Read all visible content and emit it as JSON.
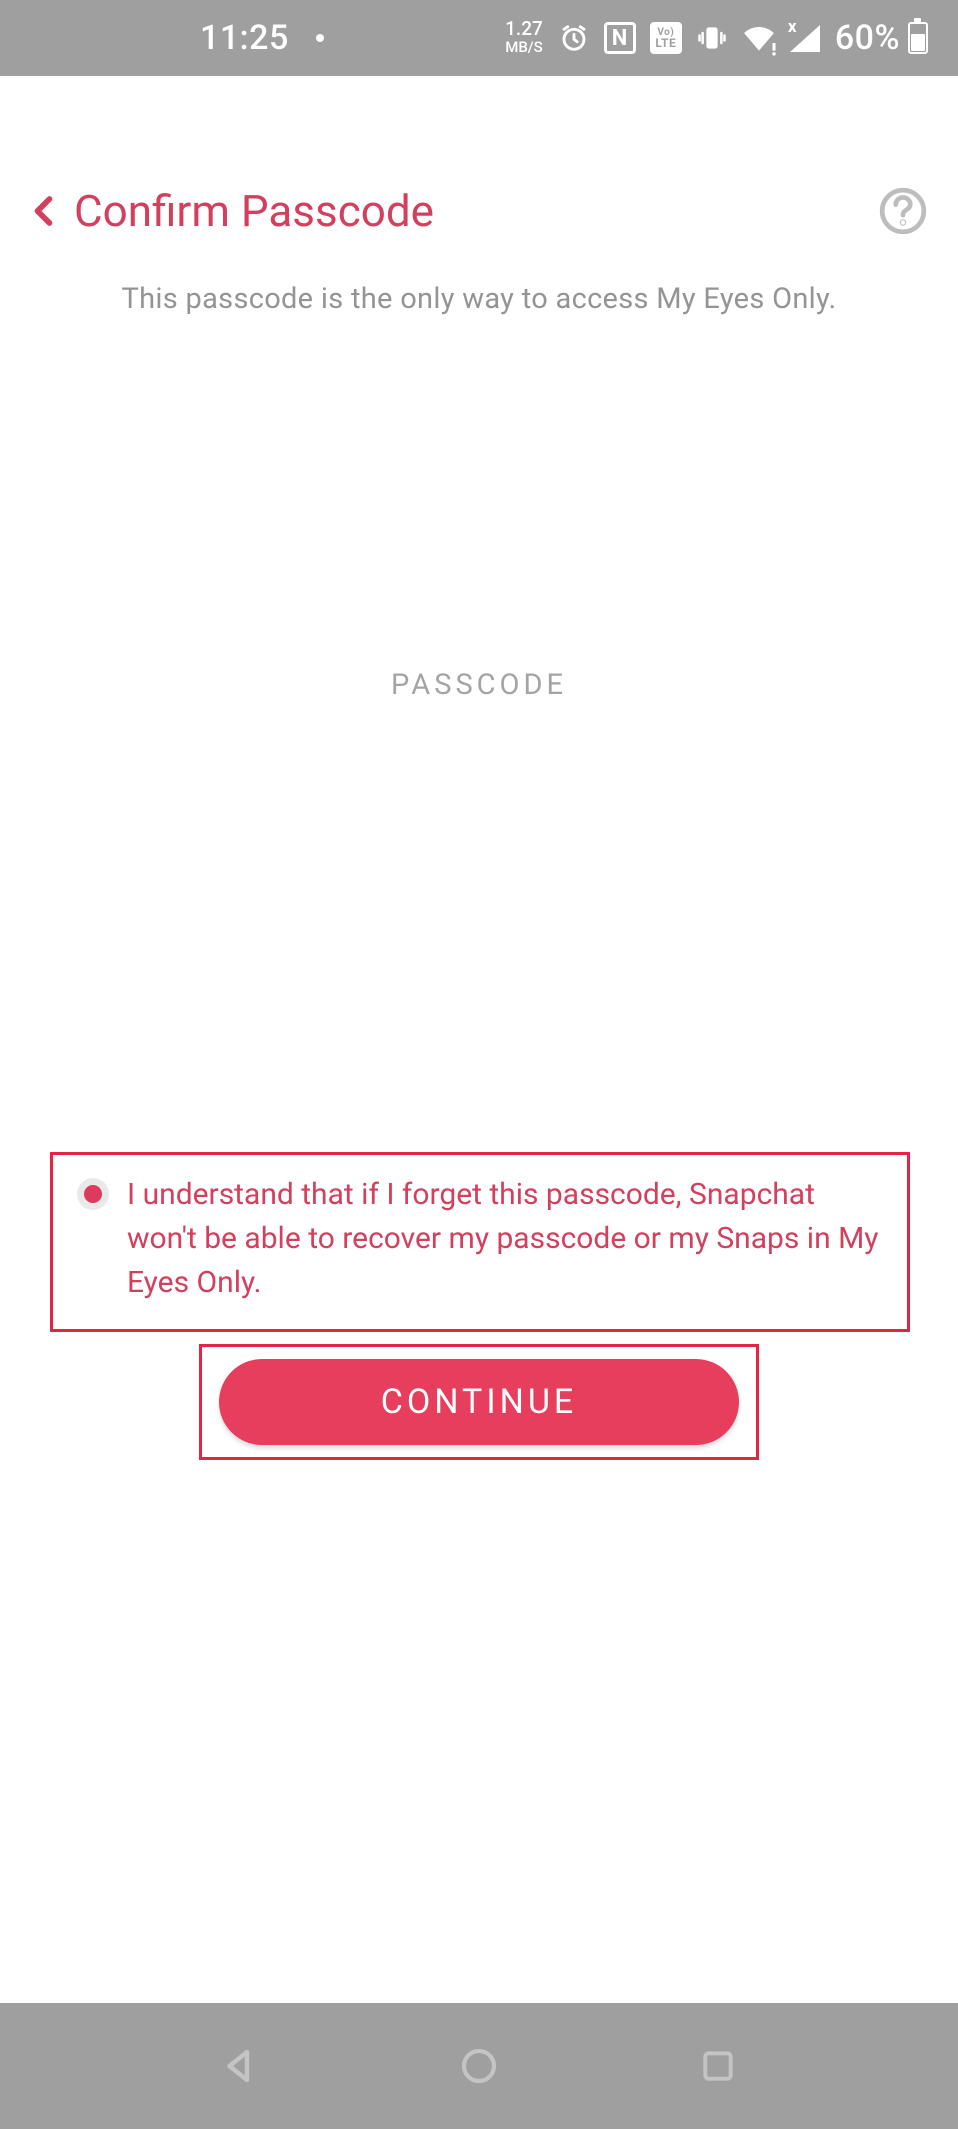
{
  "status_bar": {
    "time": "11:25",
    "net_speed_value": "1.27",
    "net_speed_unit": "MB/S",
    "volte_top": "Vo)",
    "volte_bot": "LTE",
    "battery_pct": "60%"
  },
  "header": {
    "title": "Confirm Passcode"
  },
  "subtitle": "This passcode is the only way to access My Eyes Only.",
  "passcode_label": "PASSCODE",
  "agreement": "I understand that if I forget this passcode, Snapchat won't be able to recover my passcode or my Snaps in My Eyes Only.",
  "continue_label": "CONTINUE",
  "colors": {
    "accent": "#d3405e",
    "button": "#e63e5c",
    "outline": "#e42345",
    "gray": "#9f9f9f"
  }
}
